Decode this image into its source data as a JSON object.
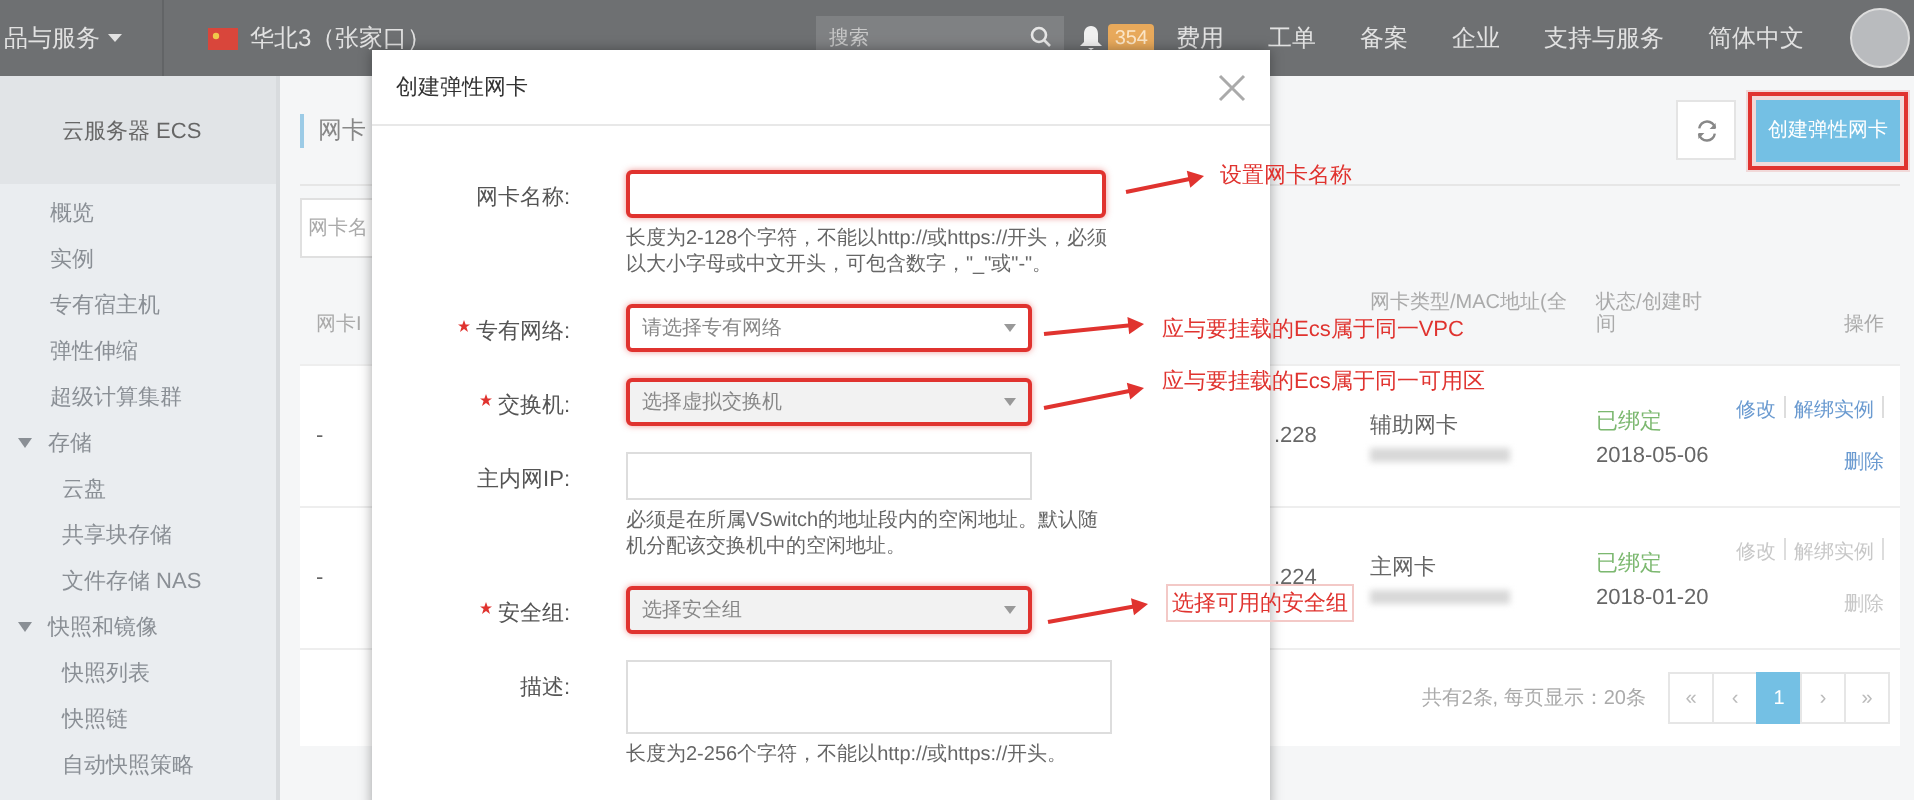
{
  "top_bar": {
    "products": "品与服务",
    "region": "华北3（张家口）",
    "search": {
      "placeholder": "搜索"
    },
    "badge": "354",
    "nav": [
      "费用",
      "工单",
      "备案",
      "企业",
      "支持与服务",
      "简体中文"
    ]
  },
  "sidebar": {
    "title": "云服务器 ECS",
    "items": [
      {
        "label": "概览"
      },
      {
        "label": "实例"
      },
      {
        "label": "专有宿主机"
      },
      {
        "label": "弹性伸缩"
      },
      {
        "label": "超级计算集群"
      },
      {
        "label": "存储",
        "expanded": true,
        "children": [
          {
            "label": "云盘"
          },
          {
            "label": "共享块存储"
          },
          {
            "label": "文件存储 NAS"
          }
        ]
      },
      {
        "label": "快照和镜像",
        "expanded": true,
        "children": [
          {
            "label": "快照列表"
          },
          {
            "label": "快照链"
          },
          {
            "label": "自动快照策略"
          }
        ]
      }
    ]
  },
  "page": {
    "title": "网卡",
    "create_button": {
      "label": "创建弹性网卡",
      "highlighted": true
    },
    "search": {
      "placeholder": "网卡名"
    }
  },
  "table": {
    "columns": [
      "网卡I",
      "网卡类型/MAC地址(全",
      "状态/创建时间",
      "操作"
    ],
    "rows": [
      {
        "id": "-",
        "ip": ".228",
        "type": "辅助网卡",
        "status": "已绑定",
        "created": "2018-05-06",
        "actions": [
          {
            "label": "修改",
            "disabled": false
          },
          {
            "label": "解绑实例",
            "disabled": false
          },
          {
            "label": "删除",
            "disabled": false
          }
        ]
      },
      {
        "id": "-",
        "ip": ".224",
        "type": "主网卡",
        "status": "已绑定",
        "created": "2018-01-20",
        "actions": [
          {
            "label": "修改",
            "disabled": true
          },
          {
            "label": "解绑实例",
            "disabled": true
          },
          {
            "label": "删除",
            "disabled": true
          }
        ]
      }
    ]
  },
  "pagination": {
    "summary": "共有2条, 每页显示：20条",
    "pages": [
      {
        "label": "«",
        "selected": false
      },
      {
        "label": "‹",
        "selected": false
      },
      {
        "label": "1",
        "selected": true
      },
      {
        "label": "›",
        "selected": false
      },
      {
        "label": "»",
        "selected": false
      }
    ]
  },
  "dialog": {
    "title": "创建弹性网卡",
    "fields": [
      {
        "kind": "input",
        "label": "网卡名称:",
        "required": false,
        "highlighted": true,
        "disabled": false,
        "hint": "长度为2-128个字符，不能以http://或https://开头，必须以大小字母或中文开头，可包含数字，\"_\"或\"-\"。"
      },
      {
        "kind": "select",
        "label": "专有网络:",
        "required": true,
        "highlighted": true,
        "disabled": false,
        "placeholder": "请选择专有网络"
      },
      {
        "kind": "select",
        "label": "交换机:",
        "required": true,
        "highlighted": true,
        "disabled": true,
        "placeholder": "选择虚拟交换机"
      },
      {
        "kind": "input",
        "label": "主内网IP:",
        "required": false,
        "highlighted": false,
        "disabled": false,
        "hint": "必须是在所属VSwitch的地址段内的空闲地址。默认随机分配该交换机中的空闲地址。"
      },
      {
        "kind": "select",
        "label": "安全组:",
        "required": true,
        "highlighted": true,
        "disabled": true,
        "placeholder": "选择安全组"
      },
      {
        "kind": "textarea",
        "label": "描述:",
        "required": false,
        "highlighted": false,
        "disabled": false,
        "hint": "长度为2-256个字符，不能以http://或https://开头。"
      }
    ]
  },
  "annotations": [
    {
      "text": "设置网卡名称",
      "boxed": false
    },
    {
      "text": "应与要挂载的Ecs属于同一VPC",
      "boxed": false
    },
    {
      "text": "应与要挂载的Ecs属于同一可用区",
      "boxed": false
    },
    {
      "text": "选择可用的安全组",
      "boxed": true
    }
  ]
}
